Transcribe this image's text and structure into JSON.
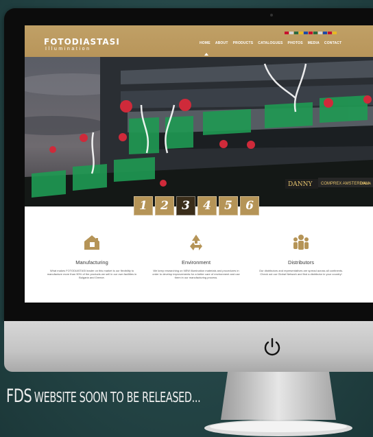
{
  "site": {
    "logo_title": "FOTODIASTASI",
    "logo_subtitle": "Illumination",
    "nav": [
      "HOME",
      "ABOUT",
      "PRODUCTS",
      "CATALOGUES",
      "PHOTOS",
      "MEDIA",
      "CONTACT"
    ],
    "flag_colors": [
      "#c8102e",
      "#d3d3d3",
      "#2a6b3f",
      "#e8b923",
      "#1f4aa8",
      "#c8102e",
      "#2a6b3f",
      "#d3d3d3",
      "#1f4aa8",
      "#c8102e",
      "#e8b923"
    ]
  },
  "slider": {
    "buttons": [
      "1",
      "2",
      "3",
      "4",
      "5",
      "6"
    ],
    "active": "3"
  },
  "storefront": {
    "sign_1": "DANNY",
    "sign_2": "COMPREX AMSTERDAM",
    "sign_3": "ITALIA"
  },
  "features": [
    {
      "icon": "house-icon",
      "title": "Manufacturing",
      "text": "What makes FOTODIASTASI leader on this market is our flexibility to manufacture more than 90% of the products we sell in our own facilities in Bulgaria and Greece."
    },
    {
      "icon": "recycle-icon",
      "title": "Environment",
      "text": "We keep researching on NEW illumination materials and procedures in order to develop improvements for a better care of environment and use them in our manufacturing process."
    },
    {
      "icon": "people-icon",
      "title": "Distributors",
      "text": "Our distributors and representatives are spread across all continents. Check out our Global Network and find a distributor in your country!"
    }
  ],
  "colors": {
    "gold": "#b59457",
    "active_slide": "#3a2d1a",
    "background": "#244546"
  },
  "caption": {
    "big": "FDS",
    "small": "WEBSITE SOON TO BE RELEASED..."
  }
}
